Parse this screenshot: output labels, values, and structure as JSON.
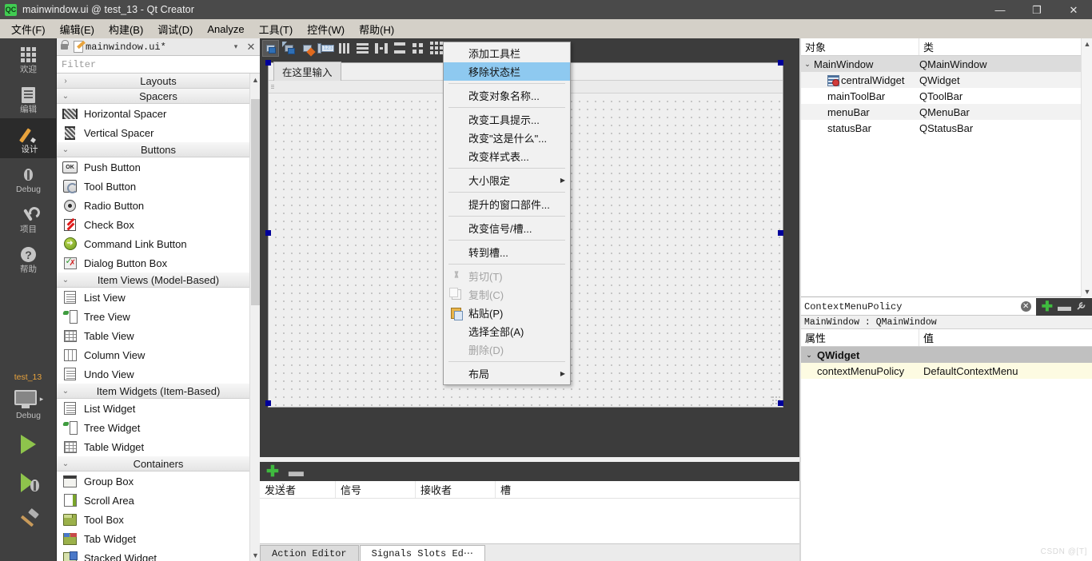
{
  "window": {
    "logo_text": "QC",
    "title": "mainwindow.ui @ test_13 - Qt Creator",
    "minimize": "—",
    "maximize": "❐",
    "close": "✕"
  },
  "menubar": {
    "items": [
      {
        "label": "文件(F)"
      },
      {
        "label": "编辑(E)"
      },
      {
        "label": "构建(B)"
      },
      {
        "label": "调试(D)"
      },
      {
        "label": "Analyze"
      },
      {
        "label": "工具(T)"
      },
      {
        "label": "控件(W)"
      },
      {
        "label": "帮助(H)"
      }
    ]
  },
  "modebar": {
    "items": [
      {
        "label": "欢迎",
        "icon": "grid-icon",
        "active": false
      },
      {
        "label": "编辑",
        "icon": "document-icon",
        "active": false
      },
      {
        "label": "设计",
        "icon": "pencil-icon",
        "active": true
      },
      {
        "label": "Debug",
        "icon": "bug-icon",
        "active": false
      },
      {
        "label": "项目",
        "icon": "wrench-icon",
        "active": false
      },
      {
        "label": "帮助",
        "icon": "question-icon",
        "active": false
      }
    ],
    "kit_name": "test_13",
    "kit_mode": "Debug"
  },
  "widgetbox": {
    "filename": "mainwindow.ui*",
    "filter_placeholder": "Filter",
    "close_glyph": "✕",
    "caret_glyph": "▾",
    "groups": [
      {
        "name": "Layouts",
        "expanded": false,
        "twisty": "›",
        "items": []
      },
      {
        "name": "Spacers",
        "expanded": true,
        "twisty": "⌄",
        "items": [
          {
            "label": "Horizontal Spacer",
            "icon": "horizontal-spacer-icon"
          },
          {
            "label": "Vertical Spacer",
            "icon": "vertical-spacer-icon"
          }
        ]
      },
      {
        "name": "Buttons",
        "expanded": true,
        "twisty": "⌄",
        "items": [
          {
            "label": "Push Button",
            "icon": "push-button-icon"
          },
          {
            "label": "Tool Button",
            "icon": "tool-button-icon"
          },
          {
            "label": "Radio Button",
            "icon": "radio-button-icon"
          },
          {
            "label": "Check Box",
            "icon": "check-box-icon"
          },
          {
            "label": "Command Link Button",
            "icon": "command-link-icon"
          },
          {
            "label": "Dialog Button Box",
            "icon": "dialog-button-box-icon"
          }
        ]
      },
      {
        "name": "Item Views (Model-Based)",
        "expanded": true,
        "twisty": "⌄",
        "items": [
          {
            "label": "List View",
            "icon": "list-view-icon"
          },
          {
            "label": "Tree View",
            "icon": "tree-view-icon"
          },
          {
            "label": "Table View",
            "icon": "table-view-icon"
          },
          {
            "label": "Column View",
            "icon": "column-view-icon"
          },
          {
            "label": "Undo View",
            "icon": "undo-view-icon"
          }
        ]
      },
      {
        "name": "Item Widgets (Item-Based)",
        "expanded": true,
        "twisty": "⌄",
        "items": [
          {
            "label": "List Widget",
            "icon": "list-widget-icon"
          },
          {
            "label": "Tree Widget",
            "icon": "tree-widget-icon"
          },
          {
            "label": "Table Widget",
            "icon": "table-widget-icon"
          }
        ]
      },
      {
        "name": "Containers",
        "expanded": true,
        "twisty": "⌄",
        "items": [
          {
            "label": "Group Box",
            "icon": "group-box-icon"
          },
          {
            "label": "Scroll Area",
            "icon": "scroll-area-icon"
          },
          {
            "label": "Tool Box",
            "icon": "tool-box-icon"
          },
          {
            "label": "Tab Widget",
            "icon": "tab-widget-icon"
          },
          {
            "label": "Stacked Widget",
            "icon": "stacked-widget-icon"
          }
        ]
      }
    ]
  },
  "designer_toolbar": {
    "buttons": [
      {
        "name": "edit-widgets",
        "selected": true
      },
      {
        "name": "edit-signals-slots",
        "selected": false
      },
      {
        "name": "edit-buddies",
        "selected": false
      },
      {
        "name": "edit-tab-order",
        "selected": false
      },
      {
        "name": "layout-horizontally",
        "selected": false
      },
      {
        "name": "layout-vertically",
        "selected": false
      },
      {
        "name": "layout-in-splitter-horizontal",
        "selected": false
      },
      {
        "name": "layout-in-splitter-vertical",
        "selected": false
      },
      {
        "name": "layout-in-form",
        "selected": false
      },
      {
        "name": "layout-in-grid",
        "selected": false
      }
    ]
  },
  "form": {
    "menubar_placeholder": "在这里输入"
  },
  "context_menu": {
    "items": [
      {
        "label": "添加工具栏",
        "sep_before": false,
        "selected": false,
        "disabled": false,
        "submenu": false,
        "icon": null
      },
      {
        "label": "移除状态栏",
        "sep_before": false,
        "selected": true,
        "disabled": false,
        "submenu": false,
        "icon": null
      },
      {
        "label": "改变对象名称...",
        "sep_before": true,
        "selected": false,
        "disabled": false,
        "submenu": false,
        "icon": null
      },
      {
        "label": "改变工具提示...",
        "sep_before": true,
        "selected": false,
        "disabled": false,
        "submenu": false,
        "icon": null
      },
      {
        "label": "改变\"这是什么\"...",
        "sep_before": false,
        "selected": false,
        "disabled": false,
        "submenu": false,
        "icon": null
      },
      {
        "label": "改变样式表...",
        "sep_before": false,
        "selected": false,
        "disabled": false,
        "submenu": false,
        "icon": null
      },
      {
        "label": "大小限定",
        "sep_before": true,
        "selected": false,
        "disabled": false,
        "submenu": true,
        "icon": null
      },
      {
        "label": "提升的窗口部件...",
        "sep_before": true,
        "selected": false,
        "disabled": false,
        "submenu": false,
        "icon": null
      },
      {
        "label": "改变信号/槽...",
        "sep_before": true,
        "selected": false,
        "disabled": false,
        "submenu": false,
        "icon": null
      },
      {
        "label": "转到槽...",
        "sep_before": true,
        "selected": false,
        "disabled": false,
        "submenu": false,
        "icon": null
      },
      {
        "label": "剪切(T)",
        "sep_before": true,
        "selected": false,
        "disabled": true,
        "submenu": false,
        "icon": "cut-icon"
      },
      {
        "label": "复制(C)",
        "sep_before": false,
        "selected": false,
        "disabled": true,
        "submenu": false,
        "icon": "copy-icon"
      },
      {
        "label": "粘贴(P)",
        "sep_before": false,
        "selected": false,
        "disabled": false,
        "submenu": false,
        "icon": "paste-icon"
      },
      {
        "label": "选择全部(A)",
        "sep_before": false,
        "selected": false,
        "disabled": false,
        "submenu": false,
        "icon": null
      },
      {
        "label": "删除(D)",
        "sep_before": false,
        "selected": false,
        "disabled": true,
        "submenu": false,
        "icon": null
      },
      {
        "label": "布局",
        "sep_before": true,
        "selected": false,
        "disabled": false,
        "submenu": true,
        "icon": null
      }
    ],
    "submenu_glyph": "▶"
  },
  "object_inspector": {
    "columns": [
      "对象",
      "类"
    ],
    "rows": [
      {
        "name": "MainWindow",
        "class": "QMainWindow",
        "indent": 0,
        "twisty": "⌄",
        "icon": null,
        "selected": true
      },
      {
        "name": "centralWidget",
        "class": "QWidget",
        "indent": 2,
        "twisty": "",
        "icon": "central-widget-icon",
        "selected": false
      },
      {
        "name": "mainToolBar",
        "class": "QToolBar",
        "indent": 2,
        "twisty": "",
        "icon": null,
        "selected": false
      },
      {
        "name": "menuBar",
        "class": "QMenuBar",
        "indent": 2,
        "twisty": "",
        "icon": null,
        "selected": false
      },
      {
        "name": "statusBar",
        "class": "QStatusBar",
        "indent": 2,
        "twisty": "",
        "icon": null,
        "selected": false
      }
    ]
  },
  "property_editor": {
    "filter_value": "ContextMenuPolicy",
    "clear_glyph": "✕",
    "add_glyph": "✚",
    "remove_glyph": "▬",
    "configure_glyph": "🔧",
    "object_line": "MainWindow : QMainWindow",
    "columns": [
      "属性",
      "值"
    ],
    "group": {
      "label": "QWidget",
      "twisty": "⌄"
    },
    "properties": [
      {
        "name": "contextMenuPolicy",
        "value": "DefaultContextMenu"
      }
    ]
  },
  "signal_slot_editor": {
    "add_glyph": "✚",
    "remove_glyph": "▬",
    "columns": [
      "发送者",
      "信号",
      "接收者",
      "槽"
    ],
    "sort_glyph": "⌄",
    "tabs": [
      {
        "label": "Action Editor",
        "active": false
      },
      {
        "label": "Signals  Slots Ed⋯",
        "active": true
      }
    ]
  },
  "watermark": "CSDN @[T]"
}
